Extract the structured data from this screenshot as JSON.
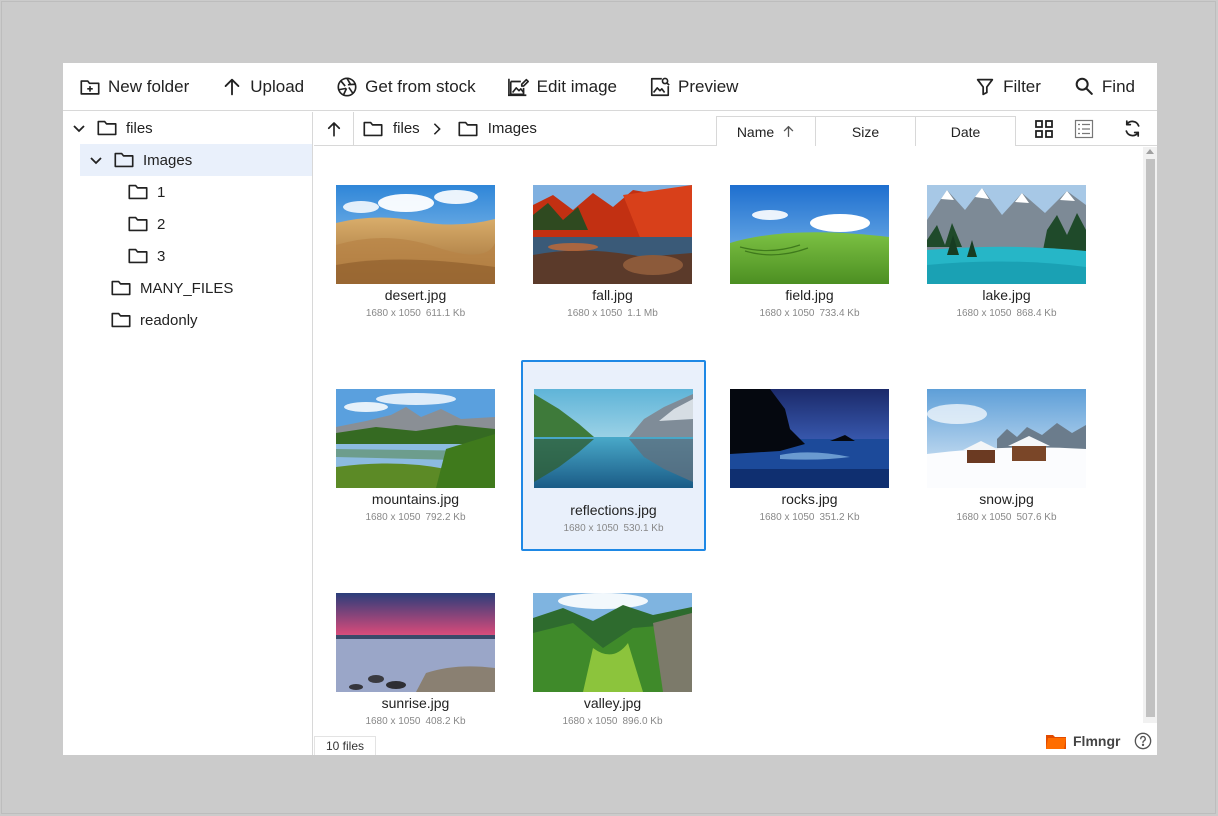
{
  "toolbar": {
    "new_folder": "New folder",
    "upload": "Upload",
    "get_from_stock": "Get from stock",
    "edit_image": "Edit image",
    "preview": "Preview",
    "filter": "Filter",
    "find": "Find"
  },
  "tree": {
    "root": "files",
    "images": "Images",
    "sub1": "1",
    "sub2": "2",
    "sub3": "3",
    "many_files": "MANY_FILES",
    "readonly": "readonly"
  },
  "path": {
    "root": "files",
    "current": "Images"
  },
  "sort": {
    "name": "Name",
    "size": "Size",
    "date": "Date",
    "active": "name",
    "direction": "ascending"
  },
  "files": [
    {
      "name": "desert.jpg",
      "dims": "1680 x 1050",
      "size": "611.1 Kb"
    },
    {
      "name": "fall.jpg",
      "dims": "1680 x 1050",
      "size": "1.1 Mb"
    },
    {
      "name": "field.jpg",
      "dims": "1680 x 1050",
      "size": "733.4 Kb"
    },
    {
      "name": "lake.jpg",
      "dims": "1680 x 1050",
      "size": "868.4 Kb"
    },
    {
      "name": "mountains.jpg",
      "dims": "1680 x 1050",
      "size": "792.2 Kb"
    },
    {
      "name": "reflections.jpg",
      "dims": "1680 x 1050",
      "size": "530.1 Kb"
    },
    {
      "name": "rocks.jpg",
      "dims": "1680 x 1050",
      "size": "351.2 Kb"
    },
    {
      "name": "snow.jpg",
      "dims": "1680 x 1050",
      "size": "507.6 Kb"
    },
    {
      "name": "sunrise.jpg",
      "dims": "1680 x 1050",
      "size": "408.2 Kb"
    },
    {
      "name": "valley.jpg",
      "dims": "1680 x 1050",
      "size": "896.0 Kb"
    }
  ],
  "status": {
    "count": "10 files"
  },
  "brand": {
    "name": "Flmngr",
    "logo_color": "#ff6d00"
  },
  "colors": {
    "accent": "#1e88e5",
    "selection_bg": "#e9f0fb"
  }
}
